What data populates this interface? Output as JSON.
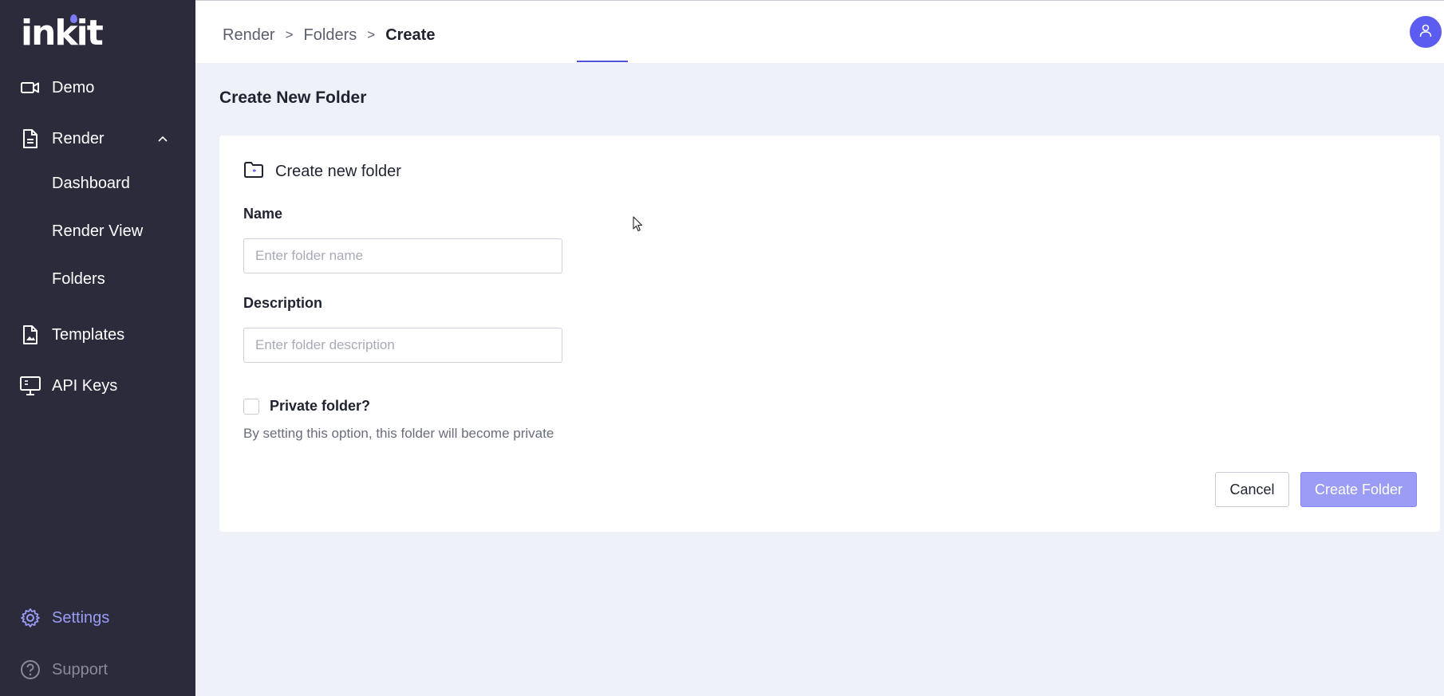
{
  "brand": {
    "logo_text": "inkit"
  },
  "sidebar": {
    "items": [
      {
        "label": "Demo",
        "icon": "video-camera-icon"
      },
      {
        "label": "Render",
        "icon": "document-icon",
        "expanded": true,
        "children": [
          {
            "label": "Dashboard"
          },
          {
            "label": "Render View"
          },
          {
            "label": "Folders"
          }
        ]
      },
      {
        "label": "Templates",
        "icon": "image-file-icon"
      },
      {
        "label": "API Keys",
        "icon": "monitor-icon"
      }
    ],
    "bottom": [
      {
        "label": "Settings",
        "icon": "gear-icon"
      },
      {
        "label": "Support",
        "icon": "help-circle-icon"
      }
    ]
  },
  "header": {
    "breadcrumb": [
      "Render",
      "Folders",
      "Create"
    ],
    "separator": ">",
    "avatar_icon": "user-icon"
  },
  "page": {
    "title": "Create New Folder"
  },
  "form": {
    "card_title": "Create new folder",
    "card_icon": "folder-icon",
    "name": {
      "label": "Name",
      "placeholder": "Enter folder name",
      "value": ""
    },
    "description": {
      "label": "Description",
      "placeholder": "Enter folder description",
      "value": ""
    },
    "private": {
      "label": "Private folder?",
      "checked": false,
      "helper": "By setting this option, this folder will become private"
    },
    "cancel_label": "Cancel",
    "submit_label": "Create Folder"
  },
  "colors": {
    "sidebar_bg": "#2b2b3c",
    "accent": "#5b5cf0",
    "accent_light": "#9b9cf5",
    "page_bg": "#eef1f8"
  }
}
